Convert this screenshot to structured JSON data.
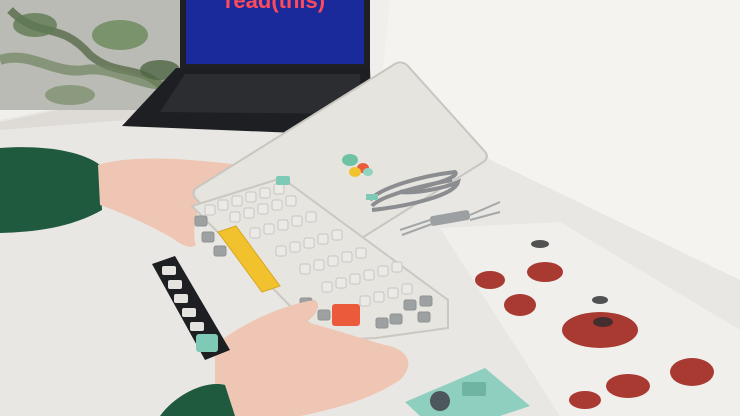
{
  "scene": {
    "screen_text": "read(this)",
    "colors": {
      "wall": "#f1f0ec",
      "desk": "#e8e6e2",
      "laptop_body": "#1f2023",
      "laptop_screen": "#1b2a9a",
      "screen_text": "#ff4a5a",
      "sleeve": "#1f5a3e",
      "skin": "#efc6b3",
      "keyboard_case": "#e5e3de",
      "keycap_light": "#e9e8e4",
      "keycap_grey": "#9fa2a3",
      "keycap_yellow": "#f2c12e",
      "keycap_orange": "#ea5a3b",
      "keycap_teal": "#7fcab7",
      "cable": "#8b8d90"
    }
  }
}
